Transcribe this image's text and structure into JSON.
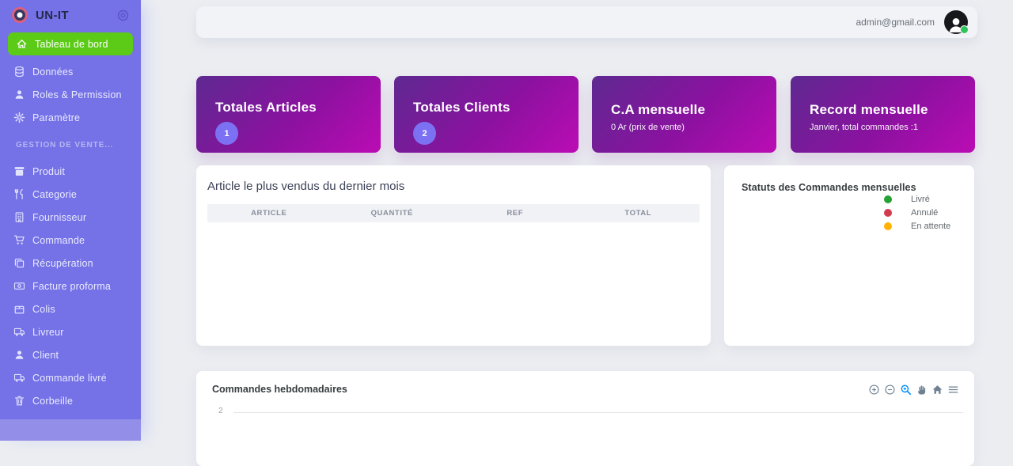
{
  "brand": {
    "name": "UN-IT"
  },
  "topbar": {
    "email": "admin@gmail.com"
  },
  "sidebar": {
    "section_label": "GESTION DE VENTE...",
    "items_top": [
      {
        "label": "Tableau de bord",
        "icon": "home-icon",
        "active": true
      },
      {
        "label": "Données",
        "icon": "database-icon",
        "active": false
      },
      {
        "label": "Roles & Permission",
        "icon": "user-icon",
        "active": false
      },
      {
        "label": "Paramètre",
        "icon": "gear-icon",
        "active": false
      }
    ],
    "items_vente": [
      {
        "label": "Produit",
        "icon": "box-icon"
      },
      {
        "label": "Categorie",
        "icon": "utensils-icon"
      },
      {
        "label": "Fournisseur",
        "icon": "building-icon"
      },
      {
        "label": "Commande",
        "icon": "cart-icon"
      },
      {
        "label": "Récupération",
        "icon": "copy-icon"
      },
      {
        "label": "Facture proforma",
        "icon": "money-icon"
      },
      {
        "label": "Colis",
        "icon": "package-icon"
      },
      {
        "label": "Livreur",
        "icon": "truck-icon"
      },
      {
        "label": "Client",
        "icon": "user-icon"
      },
      {
        "label": "Commande livré",
        "icon": "truck-icon"
      },
      {
        "label": "Corbeille",
        "icon": "trash-icon"
      }
    ]
  },
  "stat_cards": [
    {
      "title": "Totales Articles",
      "badge": "1"
    },
    {
      "title": "Totales Clients",
      "badge": "2"
    },
    {
      "title": "C.A mensuelle",
      "subtitle": "0 Ar (prix de vente)"
    },
    {
      "title": "Record mensuelle",
      "subtitle": "Janvier, total commandes :1"
    }
  ],
  "articles_panel": {
    "title": "Article le plus vendus du dernier mois",
    "columns": [
      "ARTICLE",
      "QUANTITÉ",
      "REF",
      "TOTAL"
    ],
    "rows": []
  },
  "status_panel": {
    "title": "Statuts des Commandes mensuelles",
    "legend": [
      {
        "label": "Livré",
        "color": "#26a234"
      },
      {
        "label": "Annulé",
        "color": "#d43a4e"
      },
      {
        "label": "En attente",
        "color": "#ffb300"
      }
    ]
  },
  "weekly_panel": {
    "title": "Commandes hebdomadaires",
    "y_ticks": [
      "2"
    ],
    "toolbar_icons": [
      "zoom-in-icon",
      "zoom-out-icon",
      "selection-zoom-icon",
      "pan-icon",
      "home-icon",
      "menu-icon"
    ]
  },
  "colors": {
    "sidebar": "#7571e6",
    "sidebar_bottom": "#938fe9",
    "active_item_green": "#5ccb17",
    "card_gradient_start": "#5e2990",
    "card_gradient_end": "#bb0cb4",
    "badge_purple": "#7d71f3",
    "toolbar_icon": "#6E8192",
    "toolbar_active": "#008FFB",
    "online_dot": "#2ec45a"
  }
}
